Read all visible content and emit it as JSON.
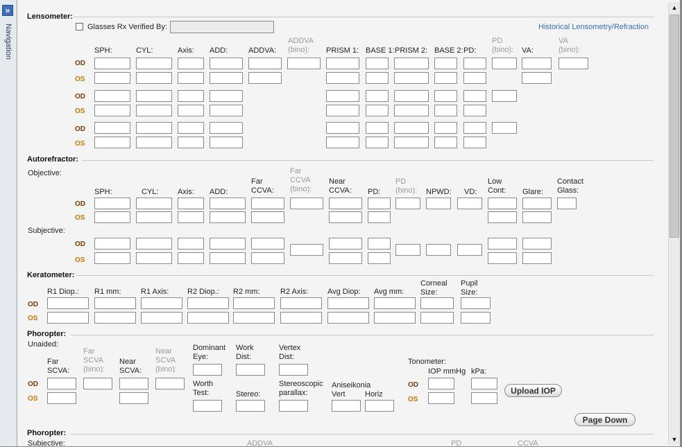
{
  "navigation": {
    "label": "Navigation",
    "toggle_icon": "»"
  },
  "lensometer": {
    "title": "Lensometer:",
    "glasses_verified_label": "Glasses Rx Verified By:",
    "historical_link": "Historical Lensometry/Refraction",
    "headers": {
      "sph": "SPH:",
      "cyl": "CYL:",
      "axis": "Axis:",
      "add": "ADD:",
      "addva": "ADDVA:",
      "addva_bino": "ADDVA\n(bino):",
      "prism1": "PRISM 1:",
      "base1": "BASE 1:",
      "prism2": "PRISM 2:",
      "base2": "BASE 2:",
      "pd": "PD:",
      "pd_bino": "PD\n(bino):",
      "va": "VA:",
      "va_bino": "VA\n(bino):"
    }
  },
  "eyes": {
    "od": "OD",
    "os": "OS"
  },
  "autorefractor": {
    "title": "Autorefractor:",
    "objective_label": "Objective:",
    "subjective_label": "Subjective:",
    "headers": {
      "sph": "SPH:",
      "cyl": "CYL:",
      "axis": "Axis:",
      "add": "ADD:",
      "far_ccva": "Far\nCCVA:",
      "far_ccva_bino": "Far\nCCVA\n(bino):",
      "near_ccva": "Near\nCCVA:",
      "pd": "PD:",
      "pd_bino": "PD\n(bino):",
      "npwd": "NPWD:",
      "vd": "VD:",
      "low_cont": "Low\nCont:",
      "glare": "Glare:",
      "contact_glass": "Contact\nGlass:"
    }
  },
  "keratometer": {
    "title": "Keratometer:",
    "headers": {
      "r1_diop": "R1 Diop.:",
      "r1_mm": "R1 mm:",
      "r1_axis": "R1 Axis:",
      "r2_diop": "R2 Diop.:",
      "r2_mm": "R2 mm:",
      "r2_axis": "R2 Axis:",
      "avg_diop": "Avg Diop:",
      "avg_mm": "Avg mm:",
      "corneal_size": "Corneal\nSize:",
      "pupil_size": "Pupil\nSize:"
    }
  },
  "phoropter": {
    "title": "Phoropter:",
    "unaided_label": "Unaided:",
    "headers": {
      "far_scva": "Far\nSCVA:",
      "far_scva_bino": "Far\nSCVA\n(bino):",
      "near_scva": "Near\nSCVA:",
      "near_scva_bino": "Near\nSCVA\n(bino):",
      "dominant_eye": "Dominant\nEye:",
      "work_dist": "Work\nDist:",
      "vertex_dist": "Vertex\nDist:",
      "worth_test": "Worth\nTest:",
      "stereo": "Stereo:",
      "stereoscopic_parallax": "Stereoscopic\nparallax:",
      "aniseikonia": "Aniseikonia",
      "vert": "Vert",
      "horiz": "Horiz"
    },
    "tonometer_label": "Tonometer:",
    "iop_mmhg": "IOP mmHg",
    "kpa": "kPa:",
    "upload_iop_button": "Upload IOP",
    "page_down_button": "Page Down"
  },
  "phoropter2": {
    "title": "Phoropter:",
    "subjective_label": "Subjective:",
    "addva": "ADDVA",
    "pd": "PD",
    "ccva": "CCVA"
  },
  "scrollbar": {
    "up_icon": "▲",
    "down_icon": "▼"
  }
}
